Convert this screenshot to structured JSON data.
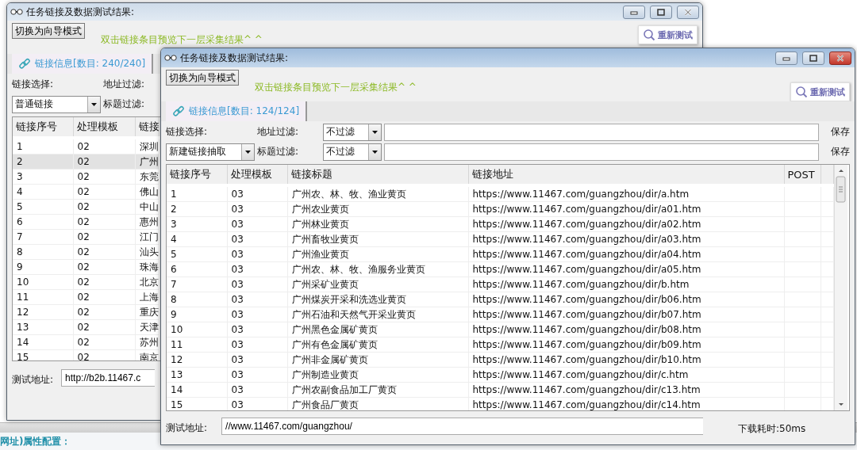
{
  "background_app": {
    "section_label": "网址)属性配置："
  },
  "windows": [
    {
      "title": "任务链接及数据测试结果:",
      "active": false,
      "mode_button": "切换为向导模式",
      "hint": "双击链接条目预览下一层采集结果^ ^",
      "retest_button": "重新测试",
      "tab": {
        "label": "链接信息[数目: 240/240]",
        "selected": true
      },
      "link_select": {
        "label": "链接选择:",
        "value": "普通链接"
      },
      "address_filter": {
        "label": "地址过滤:"
      },
      "title_filter": {
        "label": "标题过滤:"
      },
      "table": {
        "columns": [
          "链接序号",
          "处理模板",
          "链接"
        ],
        "rows": [
          {
            "cells": [
              "1",
              "02",
              "深圳"
            ],
            "selected": false
          },
          {
            "cells": [
              "2",
              "02",
              "广州"
            ],
            "selected": true
          },
          {
            "cells": [
              "3",
              "02",
              "东莞"
            ],
            "selected": false
          },
          {
            "cells": [
              "4",
              "02",
              "佛山"
            ],
            "selected": false
          },
          {
            "cells": [
              "5",
              "02",
              "中山"
            ],
            "selected": false
          },
          {
            "cells": [
              "6",
              "02",
              "惠州"
            ],
            "selected": false
          },
          {
            "cells": [
              "7",
              "02",
              "江门"
            ],
            "selected": false
          },
          {
            "cells": [
              "8",
              "02",
              "汕头"
            ],
            "selected": false
          },
          {
            "cells": [
              "9",
              "02",
              "珠海"
            ],
            "selected": false
          },
          {
            "cells": [
              "10",
              "02",
              "北京"
            ],
            "selected": false
          },
          {
            "cells": [
              "11",
              "02",
              "上海"
            ],
            "selected": false
          },
          {
            "cells": [
              "12",
              "02",
              "重庆"
            ],
            "selected": false
          },
          {
            "cells": [
              "13",
              "02",
              "天津"
            ],
            "selected": false
          },
          {
            "cells": [
              "14",
              "02",
              "苏州"
            ],
            "selected": false
          },
          {
            "cells": [
              "15",
              "02",
              "南京"
            ],
            "selected": false
          }
        ]
      },
      "test_address": {
        "label": "测试地址:",
        "value": "http://b2b.11467.c"
      }
    },
    {
      "title": "任务链接及数据测试结果:",
      "active": true,
      "mode_button": "切换为向导模式",
      "hint": "双击链接条目预览下一层采集结果^ ^",
      "retest_button": "重新测试",
      "tab": {
        "label": "链接信息[数目: 124/124]",
        "selected": true
      },
      "link_select": {
        "label": "链接选择:",
        "value": "新建链接抽取"
      },
      "address_filter": {
        "label": "地址过滤:",
        "value": "不过滤",
        "save": "保存"
      },
      "title_filter": {
        "label": "标题过滤:",
        "value": "不过滤",
        "save": "保存"
      },
      "table": {
        "columns": [
          "链接序号",
          "处理模板",
          "链接标题",
          "链接地址",
          "POST"
        ],
        "rows": [
          {
            "cells": [
              "1",
              "03",
              "广州农、林、牧、渔业黄页",
              "https://www.11467.com/guangzhou/dir/a.htm"
            ],
            "selected": false
          },
          {
            "cells": [
              "2",
              "03",
              "广州农业黄页",
              "https://www.11467.com/guangzhou/dir/a01.htm"
            ],
            "selected": false
          },
          {
            "cells": [
              "3",
              "03",
              "广州林业黄页",
              "https://www.11467.com/guangzhou/dir/a02.htm"
            ],
            "selected": false
          },
          {
            "cells": [
              "4",
              "03",
              "广州畜牧业黄页",
              "https://www.11467.com/guangzhou/dir/a03.htm"
            ],
            "selected": false
          },
          {
            "cells": [
              "5",
              "03",
              "广州渔业黄页",
              "https://www.11467.com/guangzhou/dir/a04.htm"
            ],
            "selected": false
          },
          {
            "cells": [
              "6",
              "03",
              "广州农、林、牧、渔服务业黄页",
              "https://www.11467.com/guangzhou/dir/a05.htm"
            ],
            "selected": false
          },
          {
            "cells": [
              "7",
              "03",
              "广州采矿业黄页",
              "https://www.11467.com/guangzhou/dir/b.htm"
            ],
            "selected": false
          },
          {
            "cells": [
              "8",
              "03",
              "广州煤炭开采和洗选业黄页",
              "https://www.11467.com/guangzhou/dir/b06.htm"
            ],
            "selected": false
          },
          {
            "cells": [
              "9",
              "03",
              "广州石油和天然气开采业黄页",
              "https://www.11467.com/guangzhou/dir/b07.htm"
            ],
            "selected": false
          },
          {
            "cells": [
              "10",
              "03",
              "广州黑色金属矿黄页",
              "https://www.11467.com/guangzhou/dir/b08.htm"
            ],
            "selected": false
          },
          {
            "cells": [
              "11",
              "03",
              "广州有色金属矿黄页",
              "https://www.11467.com/guangzhou/dir/b09.htm"
            ],
            "selected": false
          },
          {
            "cells": [
              "12",
              "03",
              "广州非金属矿黄页",
              "https://www.11467.com/guangzhou/dir/b10.htm"
            ],
            "selected": false
          },
          {
            "cells": [
              "13",
              "03",
              "广州制造业黄页",
              "https://www.11467.com/guangzhou/dir/c.htm"
            ],
            "selected": false
          },
          {
            "cells": [
              "14",
              "03",
              "广州农副食品加工厂黄页",
              "https://www.11467.com/guangzhou/dir/c13.htm"
            ],
            "selected": false
          },
          {
            "cells": [
              "15",
              "03",
              "广州食品厂黄页",
              "https://www.11467.com/guangzhou/dir/c14.htm"
            ],
            "selected": false
          }
        ]
      },
      "test_address": {
        "label": "测试地址:",
        "value": "//www.11467.com/guangzhou/"
      },
      "download_time": "下载耗时:50ms"
    }
  ]
}
